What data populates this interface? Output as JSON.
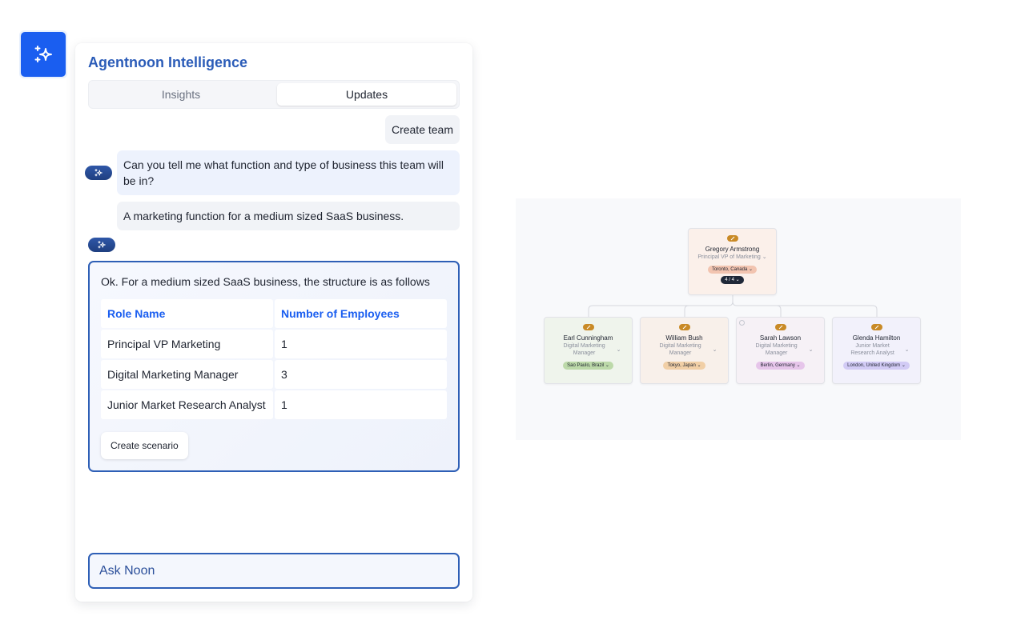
{
  "launcher": {
    "icon": "sparkle-icon"
  },
  "panel": {
    "title": "Agentnoon Intelligence",
    "tabs": [
      {
        "label": "Insights",
        "active": false
      },
      {
        "label": "Updates",
        "active": true
      }
    ]
  },
  "chat": {
    "messages": [
      {
        "role": "user",
        "text": "Create team"
      },
      {
        "role": "assistant",
        "text": "Can you tell me what function and type of business this team will be in?"
      },
      {
        "role": "user",
        "text": "A marketing function for a medium sized SaaS business."
      }
    ],
    "answer": {
      "intro": "Ok. For a medium sized SaaS business, the structure is as follows",
      "table": {
        "headers": [
          "Role Name",
          "Number of Employees"
        ],
        "rows": [
          [
            "Principal VP Marketing",
            "1"
          ],
          [
            "Digital Marketing Manager",
            "3"
          ],
          [
            "Junior Market Research Analyst",
            "1"
          ]
        ]
      },
      "button_label": "Create scenario"
    },
    "input_placeholder": "Ask Noon"
  },
  "org_chart": {
    "root": {
      "name": "Gregory Armstrong",
      "role": "Principal VP of Marketing",
      "location": "Toronto, Canada",
      "location_color": "#f2c4b0",
      "reports": "4 / 4"
    },
    "children": [
      {
        "name": "Earl Cunningham",
        "role": "Digital Marketing Manager",
        "location": "Sao Paulo, Brazil",
        "location_color": "#bcd9a9"
      },
      {
        "name": "William Bush",
        "role": "Digital Marketing Manager",
        "location": "Tokyo, Japan",
        "location_color": "#f1cfa6"
      },
      {
        "name": "Sarah Lawson",
        "role": "Digital Marketing Manager",
        "location": "Berlin, Germany",
        "location_color": "#e6c5ea"
      },
      {
        "name": "Glenda Hamilton",
        "role": "Junior Market Research Analyst",
        "location": "London, United Kingdom",
        "location_color": "#d2cbf5"
      }
    ]
  }
}
